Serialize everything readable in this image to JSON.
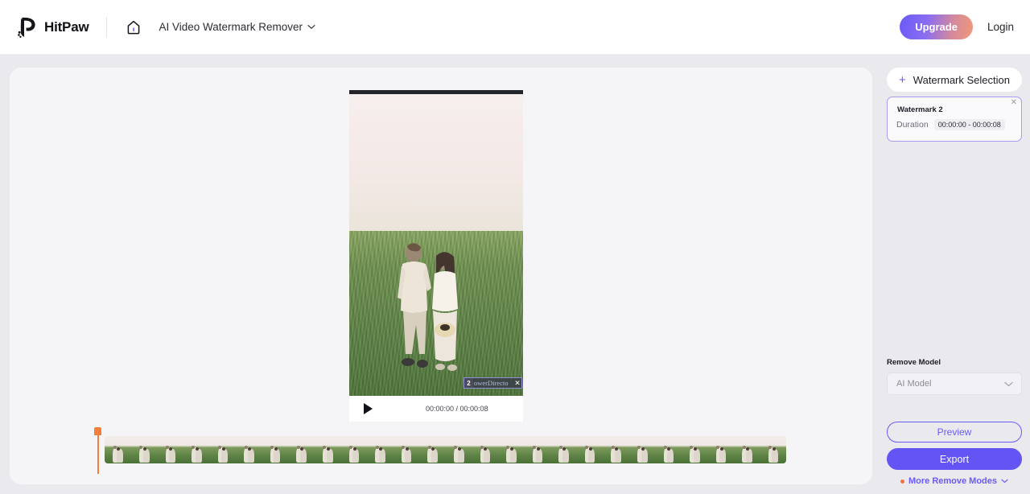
{
  "header": {
    "brand_name": "HitPaw",
    "logo_icon": "hitpaw-logo-icon",
    "home_icon": "home-icon",
    "app_selector": {
      "label": "AI Video Watermark Remover",
      "chevron_icon": "chevron-down-icon"
    },
    "upgrade_label": "Upgrade",
    "login_label": "Login",
    "accent_purple": "#6a5af9",
    "accent_orange": "#f2703a"
  },
  "canvas": {
    "video": {
      "play_icon": "play-icon",
      "time_display": "00:00:00 / 00:00:08",
      "watermark_overlay": {
        "number": "2",
        "text": "owerDirecto",
        "close_icon": "close-icon"
      }
    },
    "timeline": {
      "playhead_icon": "playhead-marker-icon",
      "frame_count": 26
    }
  },
  "sidebar": {
    "watermark_selection": {
      "plus_icon": "plus-icon",
      "label": "Watermark Selection"
    },
    "watermark_card": {
      "title": "Watermark 2",
      "duration_label": "Duration",
      "duration_value": "00:00:00 - 00:00:08",
      "close_icon": "close-icon"
    },
    "remove_model": {
      "label": "Remove Model",
      "selected_value": "AI Model",
      "chevron_icon": "chevron-down-icon"
    },
    "preview_label": "Preview",
    "export_label": "Export",
    "more_modes": {
      "label": "More Remove Modes",
      "badge_dot": "new-badge-dot",
      "chevron_icon": "chevron-down-icon"
    }
  }
}
